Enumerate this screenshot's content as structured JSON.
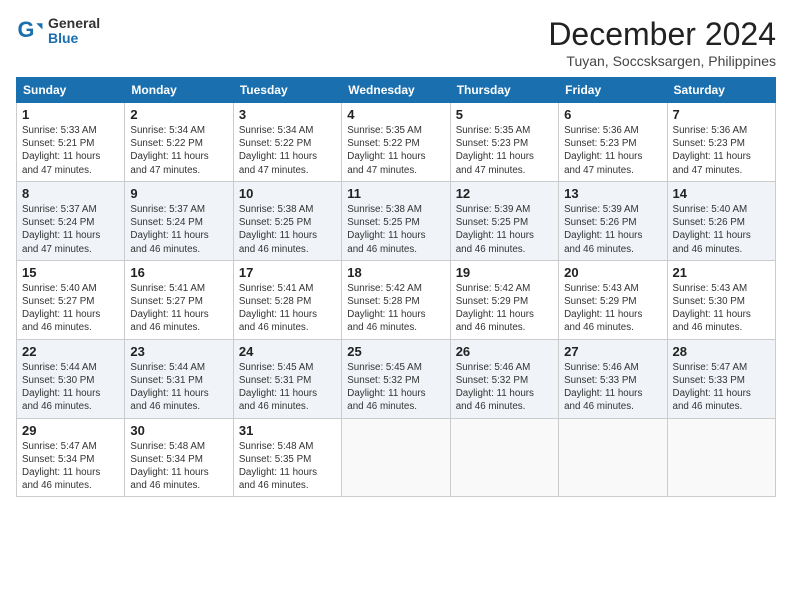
{
  "logo": {
    "general": "General",
    "blue": "Blue"
  },
  "title": "December 2024",
  "subtitle": "Tuyan, Soccsksargen, Philippines",
  "days_of_week": [
    "Sunday",
    "Monday",
    "Tuesday",
    "Wednesday",
    "Thursday",
    "Friday",
    "Saturday"
  ],
  "weeks": [
    [
      {
        "day": 1,
        "text": "Sunrise: 5:33 AM\nSunset: 5:21 PM\nDaylight: 11 hours\nand 47 minutes."
      },
      {
        "day": 2,
        "text": "Sunrise: 5:34 AM\nSunset: 5:22 PM\nDaylight: 11 hours\nand 47 minutes."
      },
      {
        "day": 3,
        "text": "Sunrise: 5:34 AM\nSunset: 5:22 PM\nDaylight: 11 hours\nand 47 minutes."
      },
      {
        "day": 4,
        "text": "Sunrise: 5:35 AM\nSunset: 5:22 PM\nDaylight: 11 hours\nand 47 minutes."
      },
      {
        "day": 5,
        "text": "Sunrise: 5:35 AM\nSunset: 5:23 PM\nDaylight: 11 hours\nand 47 minutes."
      },
      {
        "day": 6,
        "text": "Sunrise: 5:36 AM\nSunset: 5:23 PM\nDaylight: 11 hours\nand 47 minutes."
      },
      {
        "day": 7,
        "text": "Sunrise: 5:36 AM\nSunset: 5:23 PM\nDaylight: 11 hours\nand 47 minutes."
      }
    ],
    [
      {
        "day": 8,
        "text": "Sunrise: 5:37 AM\nSunset: 5:24 PM\nDaylight: 11 hours\nand 47 minutes."
      },
      {
        "day": 9,
        "text": "Sunrise: 5:37 AM\nSunset: 5:24 PM\nDaylight: 11 hours\nand 46 minutes."
      },
      {
        "day": 10,
        "text": "Sunrise: 5:38 AM\nSunset: 5:25 PM\nDaylight: 11 hours\nand 46 minutes."
      },
      {
        "day": 11,
        "text": "Sunrise: 5:38 AM\nSunset: 5:25 PM\nDaylight: 11 hours\nand 46 minutes."
      },
      {
        "day": 12,
        "text": "Sunrise: 5:39 AM\nSunset: 5:25 PM\nDaylight: 11 hours\nand 46 minutes."
      },
      {
        "day": 13,
        "text": "Sunrise: 5:39 AM\nSunset: 5:26 PM\nDaylight: 11 hours\nand 46 minutes."
      },
      {
        "day": 14,
        "text": "Sunrise: 5:40 AM\nSunset: 5:26 PM\nDaylight: 11 hours\nand 46 minutes."
      }
    ],
    [
      {
        "day": 15,
        "text": "Sunrise: 5:40 AM\nSunset: 5:27 PM\nDaylight: 11 hours\nand 46 minutes."
      },
      {
        "day": 16,
        "text": "Sunrise: 5:41 AM\nSunset: 5:27 PM\nDaylight: 11 hours\nand 46 minutes."
      },
      {
        "day": 17,
        "text": "Sunrise: 5:41 AM\nSunset: 5:28 PM\nDaylight: 11 hours\nand 46 minutes."
      },
      {
        "day": 18,
        "text": "Sunrise: 5:42 AM\nSunset: 5:28 PM\nDaylight: 11 hours\nand 46 minutes."
      },
      {
        "day": 19,
        "text": "Sunrise: 5:42 AM\nSunset: 5:29 PM\nDaylight: 11 hours\nand 46 minutes."
      },
      {
        "day": 20,
        "text": "Sunrise: 5:43 AM\nSunset: 5:29 PM\nDaylight: 11 hours\nand 46 minutes."
      },
      {
        "day": 21,
        "text": "Sunrise: 5:43 AM\nSunset: 5:30 PM\nDaylight: 11 hours\nand 46 minutes."
      }
    ],
    [
      {
        "day": 22,
        "text": "Sunrise: 5:44 AM\nSunset: 5:30 PM\nDaylight: 11 hours\nand 46 minutes."
      },
      {
        "day": 23,
        "text": "Sunrise: 5:44 AM\nSunset: 5:31 PM\nDaylight: 11 hours\nand 46 minutes."
      },
      {
        "day": 24,
        "text": "Sunrise: 5:45 AM\nSunset: 5:31 PM\nDaylight: 11 hours\nand 46 minutes."
      },
      {
        "day": 25,
        "text": "Sunrise: 5:45 AM\nSunset: 5:32 PM\nDaylight: 11 hours\nand 46 minutes."
      },
      {
        "day": 26,
        "text": "Sunrise: 5:46 AM\nSunset: 5:32 PM\nDaylight: 11 hours\nand 46 minutes."
      },
      {
        "day": 27,
        "text": "Sunrise: 5:46 AM\nSunset: 5:33 PM\nDaylight: 11 hours\nand 46 minutes."
      },
      {
        "day": 28,
        "text": "Sunrise: 5:47 AM\nSunset: 5:33 PM\nDaylight: 11 hours\nand 46 minutes."
      }
    ],
    [
      {
        "day": 29,
        "text": "Sunrise: 5:47 AM\nSunset: 5:34 PM\nDaylight: 11 hours\nand 46 minutes."
      },
      {
        "day": 30,
        "text": "Sunrise: 5:48 AM\nSunset: 5:34 PM\nDaylight: 11 hours\nand 46 minutes."
      },
      {
        "day": 31,
        "text": "Sunrise: 5:48 AM\nSunset: 5:35 PM\nDaylight: 11 hours\nand 46 minutes."
      },
      null,
      null,
      null,
      null
    ]
  ]
}
